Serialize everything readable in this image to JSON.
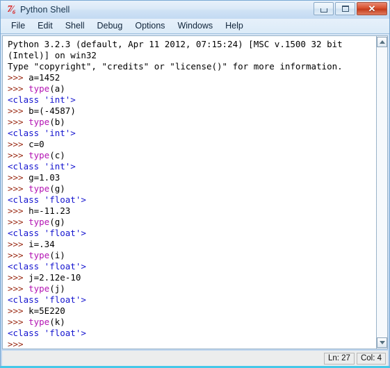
{
  "window": {
    "title": "Python Shell",
    "icon": "python-idle-icon",
    "icon_glyph": "7⁄₆",
    "controls": {
      "minimize": "–",
      "maximize": "□",
      "close": "✕"
    }
  },
  "menubar": {
    "items": [
      {
        "label": "File",
        "name": "menu-item-file"
      },
      {
        "label": "Edit",
        "name": "menu-item-edit"
      },
      {
        "label": "Shell",
        "name": "menu-item-shell"
      },
      {
        "label": "Debug",
        "name": "menu-item-debug"
      },
      {
        "label": "Options",
        "name": "menu-item-options"
      },
      {
        "label": "Windows",
        "name": "menu-item-windows"
      },
      {
        "label": "Help",
        "name": "menu-item-help"
      }
    ]
  },
  "console": {
    "lines": [
      {
        "segments": [
          {
            "text": "Python 3.2.3 (default, Apr 11 2012, 07:15:24) [MSC v.1500 32 bit",
            "style": "plain"
          }
        ]
      },
      {
        "segments": [
          {
            "text": "(Intel)] on win32",
            "style": "plain"
          }
        ]
      },
      {
        "segments": [
          {
            "text": "Type \"copyright\", \"credits\" or \"license()\" for more information.",
            "style": "plain"
          }
        ]
      },
      {
        "segments": [
          {
            "text": ">>> ",
            "style": "prompt"
          },
          {
            "text": "a=1452",
            "style": "plain"
          }
        ]
      },
      {
        "segments": [
          {
            "text": ">>> ",
            "style": "prompt"
          },
          {
            "text": "type",
            "style": "builtin"
          },
          {
            "text": "(a)",
            "style": "plain"
          }
        ]
      },
      {
        "segments": [
          {
            "text": "<class 'int'>",
            "style": "output"
          }
        ]
      },
      {
        "segments": [
          {
            "text": ">>> ",
            "style": "prompt"
          },
          {
            "text": "b=(-4587)",
            "style": "plain"
          }
        ]
      },
      {
        "segments": [
          {
            "text": ">>> ",
            "style": "prompt"
          },
          {
            "text": "type",
            "style": "builtin"
          },
          {
            "text": "(b)",
            "style": "plain"
          }
        ]
      },
      {
        "segments": [
          {
            "text": "<class 'int'>",
            "style": "output"
          }
        ]
      },
      {
        "segments": [
          {
            "text": ">>> ",
            "style": "prompt"
          },
          {
            "text": "c=0",
            "style": "plain"
          }
        ]
      },
      {
        "segments": [
          {
            "text": ">>> ",
            "style": "prompt"
          },
          {
            "text": "type",
            "style": "builtin"
          },
          {
            "text": "(c)",
            "style": "plain"
          }
        ]
      },
      {
        "segments": [
          {
            "text": "<class 'int'>",
            "style": "output"
          }
        ]
      },
      {
        "segments": [
          {
            "text": ">>> ",
            "style": "prompt"
          },
          {
            "text": "g=1.03",
            "style": "plain"
          }
        ]
      },
      {
        "segments": [
          {
            "text": ">>> ",
            "style": "prompt"
          },
          {
            "text": "type",
            "style": "builtin"
          },
          {
            "text": "(g)",
            "style": "plain"
          }
        ]
      },
      {
        "segments": [
          {
            "text": "<class 'float'>",
            "style": "output"
          }
        ]
      },
      {
        "segments": [
          {
            "text": ">>> ",
            "style": "prompt"
          },
          {
            "text": "h=-11.23",
            "style": "plain"
          }
        ]
      },
      {
        "segments": [
          {
            "text": ">>> ",
            "style": "prompt"
          },
          {
            "text": "type",
            "style": "builtin"
          },
          {
            "text": "(g)",
            "style": "plain"
          }
        ]
      },
      {
        "segments": [
          {
            "text": "<class 'float'>",
            "style": "output"
          }
        ]
      },
      {
        "segments": [
          {
            "text": ">>> ",
            "style": "prompt"
          },
          {
            "text": "i=.34",
            "style": "plain"
          }
        ]
      },
      {
        "segments": [
          {
            "text": ">>> ",
            "style": "prompt"
          },
          {
            "text": "type",
            "style": "builtin"
          },
          {
            "text": "(i)",
            "style": "plain"
          }
        ]
      },
      {
        "segments": [
          {
            "text": "<class 'float'>",
            "style": "output"
          }
        ]
      },
      {
        "segments": [
          {
            "text": ">>> ",
            "style": "prompt"
          },
          {
            "text": "j=2.12e-10",
            "style": "plain"
          }
        ]
      },
      {
        "segments": [
          {
            "text": ">>> ",
            "style": "prompt"
          },
          {
            "text": "type",
            "style": "builtin"
          },
          {
            "text": "(j)",
            "style": "plain"
          }
        ]
      },
      {
        "segments": [
          {
            "text": "<class 'float'>",
            "style": "output"
          }
        ]
      },
      {
        "segments": [
          {
            "text": ">>> ",
            "style": "prompt"
          },
          {
            "text": "k=5E220",
            "style": "plain"
          }
        ]
      },
      {
        "segments": [
          {
            "text": ">>> ",
            "style": "prompt"
          },
          {
            "text": "type",
            "style": "builtin"
          },
          {
            "text": "(k)",
            "style": "plain"
          }
        ]
      },
      {
        "segments": [
          {
            "text": "<class 'float'>",
            "style": "output"
          }
        ]
      },
      {
        "segments": [
          {
            "text": ">>>",
            "style": "prompt"
          }
        ]
      }
    ]
  },
  "scrollbar": {
    "up_arrow": "scroll-up-arrow",
    "down_arrow": "scroll-down-arrow"
  },
  "statusbar": {
    "line": "Ln: 27",
    "column": "Col: 4"
  },
  "colors": {
    "prompt": "#9a2a14",
    "builtin": "#b313b3",
    "output": "#1414cf",
    "plain": "#000000",
    "close_button": "#d9512f",
    "window_frame": "#bcd4ef"
  }
}
